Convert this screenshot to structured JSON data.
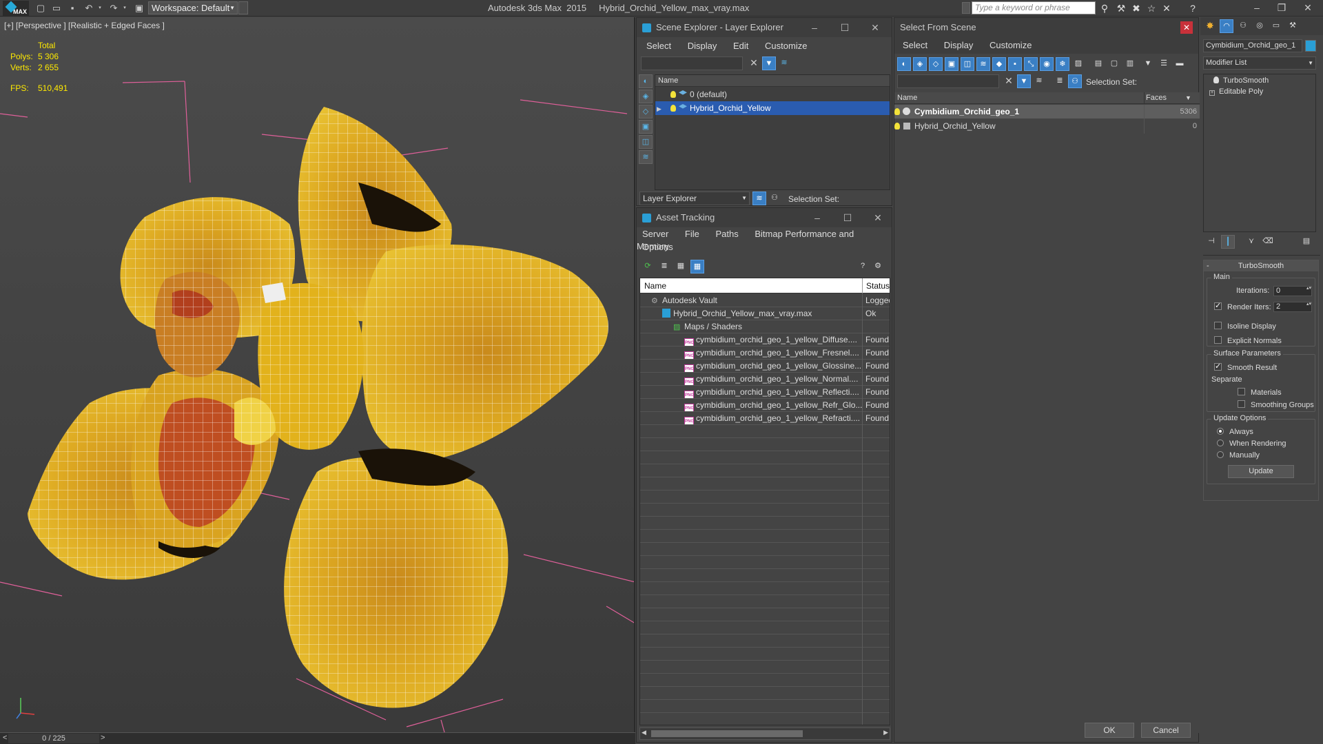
{
  "app": {
    "logo_text": "MAX",
    "workspace_label": "Workspace: Default",
    "title": "Autodesk 3ds Max  2015",
    "filename": "Hybrid_Orchid_Yellow_max_vray.max",
    "search_placeholder": "Type a keyword or phrase"
  },
  "viewport": {
    "label": "[+] [Perspective ] [Realistic + Edged Faces ]",
    "stats": {
      "total_label": "Total",
      "polys_label": "Polys:",
      "polys_value": "5 306",
      "verts_label": "Verts:",
      "verts_value": "2 655",
      "fps_label": "FPS:",
      "fps_value": "510,491"
    }
  },
  "timeline": {
    "frame": "0 / 225",
    "prev": "<",
    "next": ">"
  },
  "scene_explorer": {
    "title": "Scene Explorer - Layer Explorer",
    "menu": [
      "Select",
      "Display",
      "Edit",
      "Customize"
    ],
    "column_name": "Name",
    "rows": [
      {
        "label": "0 (default)",
        "selected": false
      },
      {
        "label": "Hybrid_Orchid_Yellow",
        "selected": true
      }
    ],
    "footer_dropdown": "Layer Explorer",
    "footer_selection_set": "Selection Set:"
  },
  "asset_tracking": {
    "title": "Asset Tracking",
    "menu_row1": [
      "Server",
      "File",
      "Paths",
      "Bitmap Performance and Memory"
    ],
    "menu_row2": [
      "Options"
    ],
    "col_name": "Name",
    "col_status": "Status",
    "rows": [
      {
        "name": "Autodesk Vault",
        "status": "Logged",
        "indent": 1,
        "icon": "vault"
      },
      {
        "name": "Hybrid_Orchid_Yellow_max_vray.max",
        "status": "Ok",
        "indent": 2,
        "icon": "max"
      },
      {
        "name": "Maps / Shaders",
        "status": "",
        "indent": 3,
        "icon": "maps"
      },
      {
        "name": "cymbidium_orchid_geo_1_yellow_Diffuse....",
        "status": "Found",
        "indent": 4,
        "icon": "png"
      },
      {
        "name": "cymbidium_orchid_geo_1_yellow_Fresnel....",
        "status": "Found",
        "indent": 4,
        "icon": "png"
      },
      {
        "name": "cymbidium_orchid_geo_1_yellow_Glossine....",
        "status": "Found",
        "indent": 4,
        "icon": "png"
      },
      {
        "name": "cymbidium_orchid_geo_1_yellow_Normal....",
        "status": "Found",
        "indent": 4,
        "icon": "png"
      },
      {
        "name": "cymbidium_orchid_geo_1_yellow_Reflecti....",
        "status": "Found",
        "indent": 4,
        "icon": "png"
      },
      {
        "name": "cymbidium_orchid_geo_1_yellow_Refr_Glo....",
        "status": "Found",
        "indent": 4,
        "icon": "png"
      },
      {
        "name": "cymbidium_orchid_geo_1_yellow_Refracti....",
        "status": "Found",
        "indent": 4,
        "icon": "png"
      }
    ]
  },
  "select_from_scene": {
    "title": "Select From Scene",
    "menu": [
      "Select",
      "Display",
      "Customize"
    ],
    "selection_set_label": "Selection Set:",
    "col_name": "Name",
    "col_faces": "Faces",
    "rows": [
      {
        "name": "Cymbidium_Orchid_geo_1",
        "faces": "5306",
        "selected": true
      },
      {
        "name": "Hybrid_Orchid_Yellow",
        "faces": "0",
        "selected": false
      }
    ],
    "ok_label": "OK",
    "cancel_label": "Cancel"
  },
  "modify_panel": {
    "object_name": "Cymbidium_Orchid_geo_1",
    "modifier_list_label": "Modifier List",
    "stack": [
      "TurboSmooth",
      "Editable Poly"
    ],
    "rollout_title": "TurboSmooth",
    "main_group": "Main",
    "iterations_label": "Iterations:",
    "iterations_value": "0",
    "render_iters_label": "Render Iters:",
    "render_iters_value": "2",
    "isoline_label": "Isoline Display",
    "explicit_normals_label": "Explicit Normals",
    "surface_group": "Surface Parameters",
    "smooth_result_label": "Smooth Result",
    "separate_label": "Separate",
    "materials_label": "Materials",
    "smoothing_groups_label": "Smoothing Groups",
    "update_group": "Update Options",
    "always_label": "Always",
    "when_rendering_label": "When Rendering",
    "manually_label": "Manually",
    "update_button": "Update"
  },
  "colors": {
    "selection_blue": "#2a5cb0",
    "stats_yellow": "#ffea00",
    "petal_yellow": "#e2b21c",
    "wire_white": "#ffffff",
    "gizmo_pink": "#e0609a"
  }
}
